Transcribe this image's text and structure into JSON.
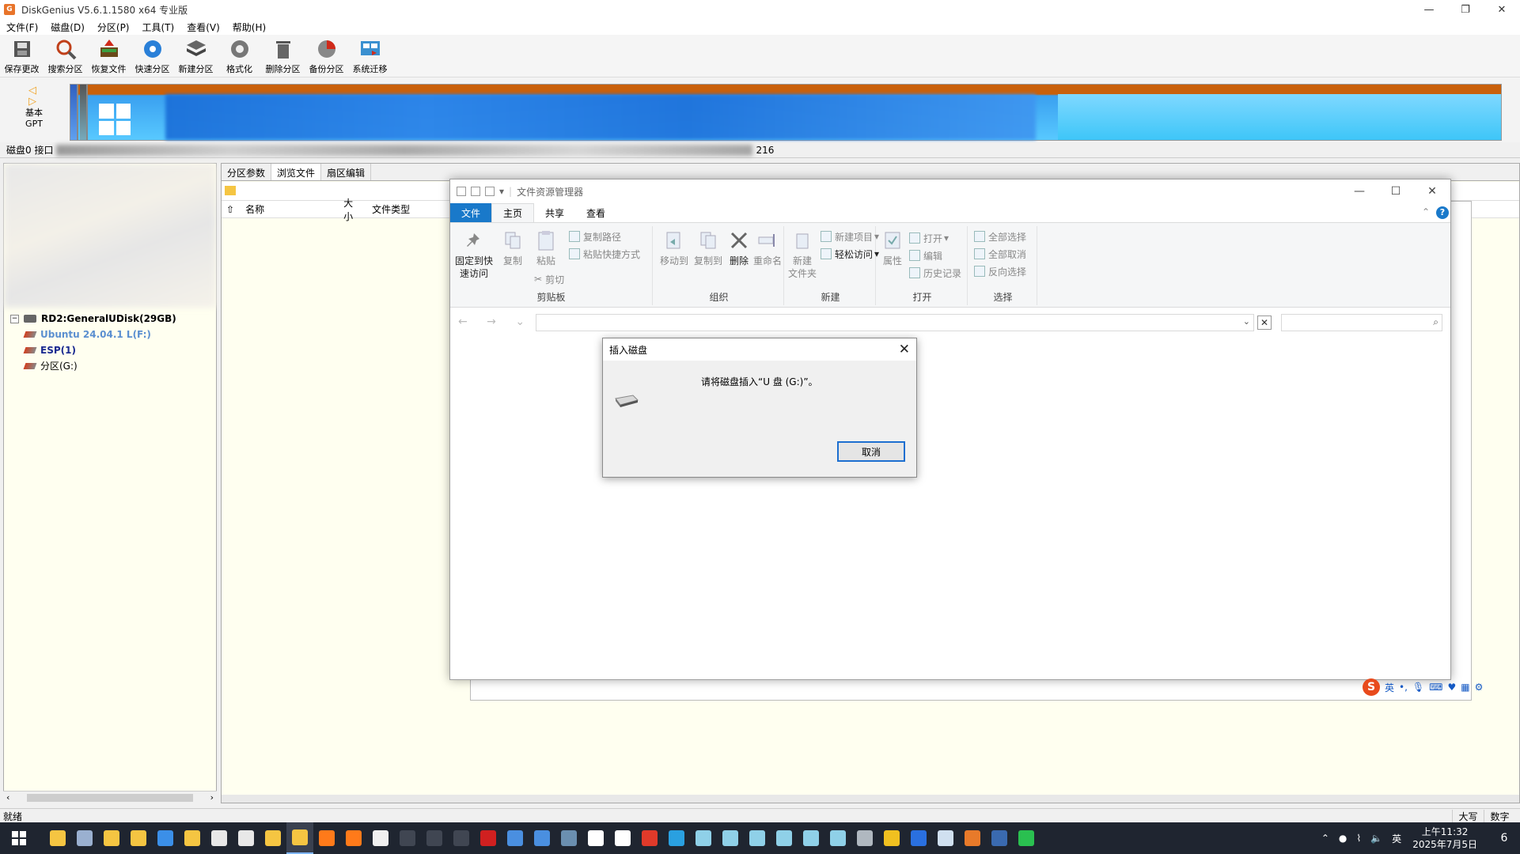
{
  "app": {
    "title": "DiskGenius V5.6.1.1580 x64 专业版",
    "icon_letter": "G",
    "controls": {
      "minimize": "—",
      "restore": "❐",
      "close": "✕"
    }
  },
  "menu": [
    "文件(F)",
    "磁盘(D)",
    "分区(P)",
    "工具(T)",
    "查看(V)",
    "帮助(H)"
  ],
  "toolbar": [
    {
      "label": "保存更改",
      "icon": "save-icon"
    },
    {
      "label": "搜索分区",
      "icon": "search-partition-icon"
    },
    {
      "label": "恢复文件",
      "icon": "recover-files-icon"
    },
    {
      "label": "快速分区",
      "icon": "quick-partition-icon"
    },
    {
      "label": "新建分区",
      "icon": "new-partition-icon"
    },
    {
      "label": "格式化",
      "icon": "format-icon"
    },
    {
      "label": "删除分区",
      "icon": "delete-partition-icon"
    },
    {
      "label": "备份分区",
      "icon": "backup-partition-icon"
    },
    {
      "label": "系统迁移",
      "icon": "system-migration-icon"
    }
  ],
  "disk_nav": {
    "arrows": "◁ ▷",
    "line1": "基本",
    "line2": "GPT"
  },
  "disk_info": {
    "prefix": "磁盘0 接口",
    "suffix": "216"
  },
  "tree": {
    "disk": "RD2:GeneralUDisk(29GB)",
    "partitions": [
      "Ubuntu 24.04.1 L(F:)",
      "ESP(1)",
      "分区(G:)"
    ]
  },
  "tabs": [
    "分区参数",
    "浏览文件",
    "扇区编辑"
  ],
  "columns": [
    "名称",
    "大小",
    "文件类型"
  ],
  "status": {
    "ready": "就绪",
    "caps": "大写",
    "num": "数字"
  },
  "explorer": {
    "title": "文件资源管理器",
    "ribbon_tabs": [
      "文件",
      "主页",
      "共享",
      "查看"
    ],
    "help": "?",
    "clipboard": {
      "pin": "固定到快\n速访问",
      "copy": "复制",
      "paste": "粘贴",
      "copy_path": "复制路径",
      "paste_shortcut": "粘贴快捷方式",
      "cut": "剪切",
      "label": "剪贴板"
    },
    "organize": {
      "move": "移动到",
      "copy_to": "复制到",
      "delete": "删除",
      "rename": "重命名",
      "label": "组织"
    },
    "new": {
      "folder": "新建\n文件夹",
      "new_item": "新建项目",
      "easy_access": "轻松访问",
      "label": "新建"
    },
    "open": {
      "properties": "属性",
      "open": "打开",
      "edit": "编辑",
      "history": "历史记录",
      "label": "打开"
    },
    "select": {
      "all": "全部选择",
      "none": "全部取消",
      "invert": "反向选择",
      "label": "选择"
    }
  },
  "dialog": {
    "title": "插入磁盘",
    "message": "请将磁盘插入“U 盘 (G:)”。",
    "cancel": "取消"
  },
  "ime": {
    "logo": "S",
    "lang": "英",
    "punct": "•,"
  },
  "taskbar": {
    "tray_lang": "英",
    "time": "上午11:32",
    "date": "2025年7月5日",
    "notifications": "6",
    "colors": [
      "#f5c542",
      "#9ab0d0",
      "#f5c542",
      "#f5c542",
      "#3b8fe8",
      "#f5c542",
      "#e8e8e8",
      "#e8e8e8",
      "#f5c542",
      "#f5c542",
      "#ff7a1a",
      "#ff7a1a",
      "#f0f0f0",
      "#404652",
      "#404652",
      "#404652",
      "#d02020",
      "#4a8fe0",
      "#4a8fe0",
      "#6b8fb0",
      "#ffffff",
      "#ffffff",
      "#e03a2a",
      "#2aa0e0",
      "#8fd0e8",
      "#8fd0e8",
      "#8fd0e8",
      "#8fd0e8",
      "#8fd0e8",
      "#8fd0e8",
      "#b0b8c0",
      "#f0c020",
      "#2a70e0",
      "#d0e0f0",
      "#e87a2a",
      "#3a6ab0",
      "#2ac050"
    ]
  }
}
